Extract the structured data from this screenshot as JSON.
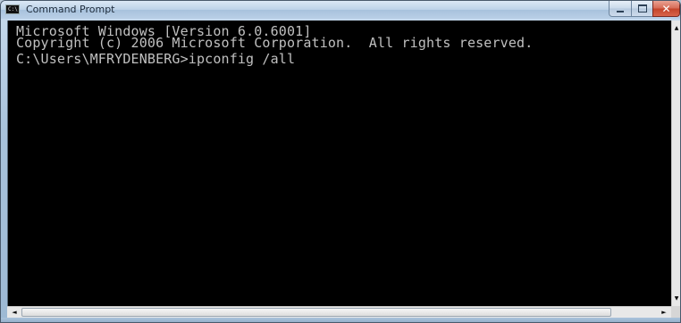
{
  "window": {
    "title": "Command Prompt",
    "icon": "console-icon",
    "icon_glyph": "C:\\",
    "controls": {
      "minimize_icon": "minimize-icon",
      "maximize_icon": "maximize-icon",
      "close_icon": "close-icon",
      "close_glyph": "✕"
    }
  },
  "console": {
    "background": "#000000",
    "foreground": "#c0c0c0",
    "lines": [
      "Microsoft Windows [Version 6.0.6001]",
      "Copyright (c) 2006 Microsoft Corporation.  All rights reserved.",
      "C:\\Users\\MFRYDENBERG>ipconfig /all"
    ]
  },
  "scrollbars": {
    "up_arrow": "▲",
    "down_arrow": "▼",
    "left_arrow": "◄",
    "right_arrow": "►"
  }
}
